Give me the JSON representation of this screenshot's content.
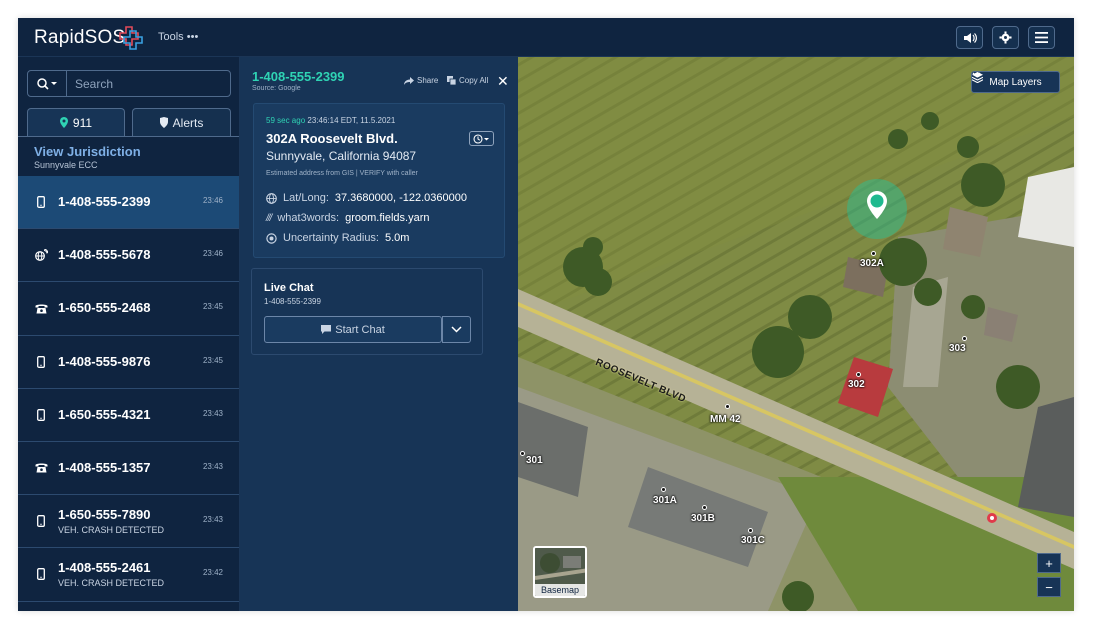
{
  "header": {
    "brand": "RapidSOS",
    "tools_label": "Tools •••",
    "icons": [
      "volume-icon",
      "settings-icon",
      "menu-icon"
    ]
  },
  "sidebar": {
    "search_placeholder": "Search",
    "tabs": [
      {
        "label": "911",
        "icon": "location-pin-icon"
      },
      {
        "label": "Alerts",
        "icon": "shield-icon"
      }
    ],
    "jurisdiction": {
      "title": "View Jurisdiction",
      "subtitle": "Sunnyvale ECC"
    },
    "calls": [
      {
        "number": "1-408-555-2399",
        "time": "23:46",
        "icon": "mobile-phone-icon",
        "sub": ""
      },
      {
        "number": "1-408-555-5678",
        "time": "23:46",
        "icon": "voip-globe-icon",
        "sub": ""
      },
      {
        "number": "1-650-555-2468",
        "time": "23:45",
        "icon": "landline-phone-icon",
        "sub": ""
      },
      {
        "number": "1-408-555-9876",
        "time": "23:45",
        "icon": "mobile-phone-icon",
        "sub": ""
      },
      {
        "number": "1-650-555-4321",
        "time": "23:43",
        "icon": "mobile-phone-icon",
        "sub": ""
      },
      {
        "number": "1-408-555-1357",
        "time": "23:43",
        "icon": "landline-phone-icon",
        "sub": ""
      },
      {
        "number": "1-650-555-7890",
        "time": "23:43",
        "icon": "mobile-phone-icon",
        "sub": "VEH. CRASH DETECTED"
      },
      {
        "number": "1-408-555-2461",
        "time": "23:42",
        "icon": "mobile-phone-icon",
        "sub": "VEH. CRASH DETECTED"
      }
    ]
  },
  "detail": {
    "number": "1-408-555-2399",
    "source": "Source: Google",
    "share_label": "Share",
    "copy_label": "Copy All",
    "ago": "59 sec ago",
    "timestamp": "23:46:14 EDT, 11.5.2021",
    "address_line1": "302A Roosevelt Blvd.",
    "address_line2": "Sunnyvale, California 94087",
    "estimate_note": "Estimated address from GIS | VERIFY with caller",
    "latlong_label": "Lat/Long:",
    "latlong_value": "37.3680000, -122.0360000",
    "w3w_label": "what3words:",
    "w3w_value": "groom.fields.yarn",
    "uncertainty_label": "Uncertainty Radius:",
    "uncertainty_value": "5.0m",
    "chat": {
      "title": "Live Chat",
      "number": "1-408-555-2399",
      "button_label": "Start Chat"
    }
  },
  "map": {
    "layers_label": "Map Layers",
    "basemap_label": "Basemap",
    "zoom_in": "+",
    "zoom_out": "−",
    "road_label": "ROOSEVELT BLVD",
    "labels": [
      "302A",
      "303",
      "302",
      "MM 42",
      "301",
      "301A",
      "301B",
      "301C"
    ]
  }
}
